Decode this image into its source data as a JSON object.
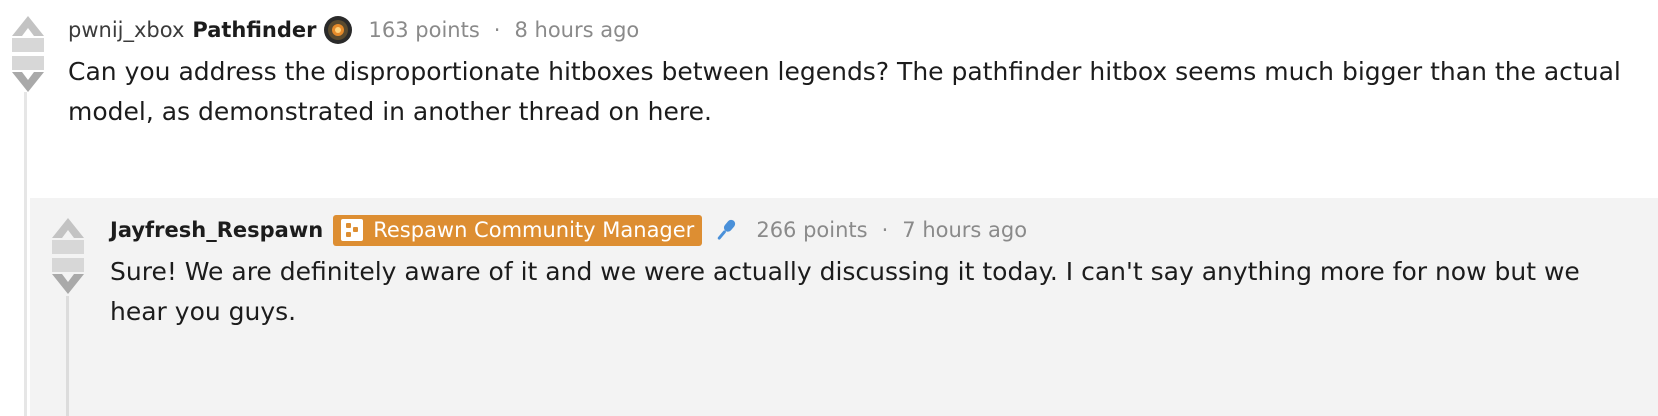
{
  "comments": [
    {
      "username": "pwnij_xbox",
      "flair": "Pathfinder",
      "points": "163 points",
      "separator": "·",
      "time": "8 hours ago",
      "text": "Can you address the disproportionate hitboxes between legends? The pathfinder hitbox seems much bigger than the actual model, as demonstrated in another thread on here."
    },
    {
      "username": "Jayfresh_Respawn",
      "badge": "Respawn Community Manager",
      "points": "266 points",
      "separator": "·",
      "time": "7 hours ago",
      "text": "Sure! We are definitely aware of it and we were actually discussing it today. I can't say anything more for now but we hear you guys."
    }
  ],
  "colors": {
    "badge": "#dd8e32",
    "reply_background": "#f3f3f3",
    "mic": "#4a90d9"
  },
  "icons": [
    "upvote-icon",
    "downvote-icon",
    "pathfinder-flair-icon",
    "moderator-badge-icon",
    "microphone-icon"
  ]
}
